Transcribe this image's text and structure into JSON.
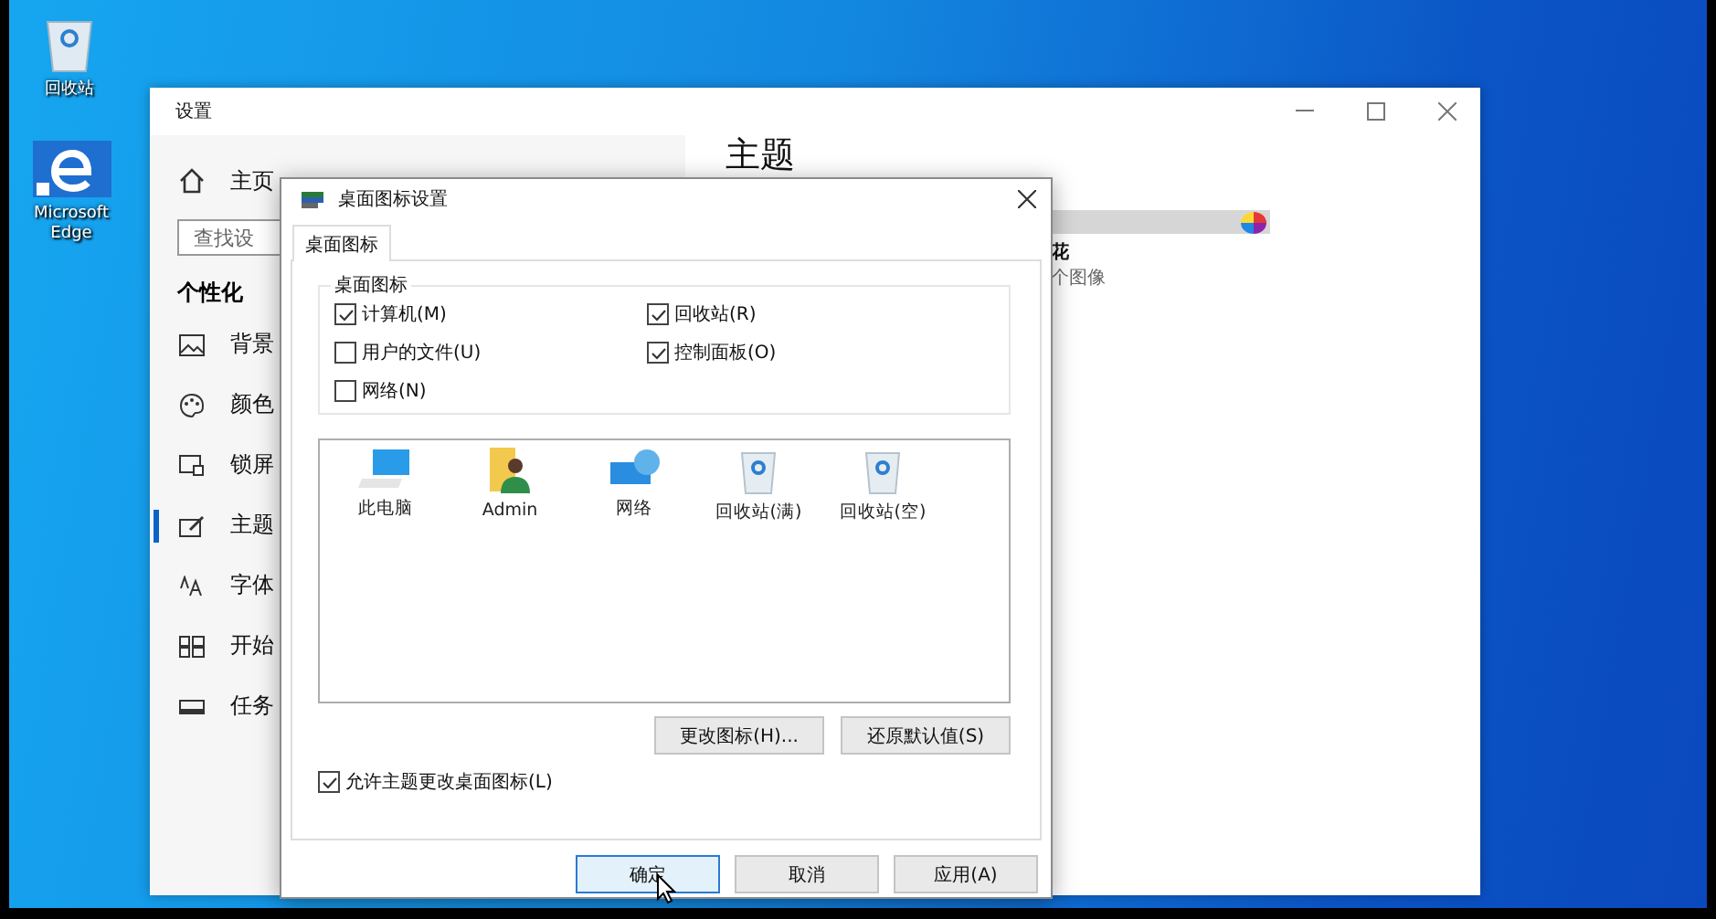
{
  "desktop": {
    "icons": [
      {
        "label": "回收站",
        "kind": "recycle"
      },
      {
        "label": "Microsoft Edge",
        "kind": "edge"
      }
    ]
  },
  "settings_window": {
    "title": "设置",
    "nav": {
      "home": "主页",
      "search": {
        "placeholder": "查找设"
      },
      "section": "个性化",
      "items": [
        {
          "label": "背景",
          "kind": "picture",
          "selected": false
        },
        {
          "label": "颜色",
          "kind": "palette",
          "selected": false
        },
        {
          "label": "锁屏",
          "kind": "lock",
          "selected": false
        },
        {
          "label": "主题",
          "kind": "theme",
          "selected": true
        },
        {
          "label": "字体",
          "kind": "font",
          "selected": false
        },
        {
          "label": "开始",
          "kind": "start",
          "selected": false
        },
        {
          "label": "任务",
          "kind": "taskbar",
          "selected": false
        }
      ]
    },
    "content": {
      "heading": "主题",
      "lines": [
        "花",
        "个图像"
      ]
    }
  },
  "dialog": {
    "title": "桌面图标设置",
    "tabs": [
      {
        "label": "桌面图标",
        "selected": true
      }
    ],
    "group": {
      "label": "桌面图标",
      "checkboxes": [
        {
          "label": "计算机(M)",
          "checked": true
        },
        {
          "label": "回收站(R)",
          "checked": true
        },
        {
          "label": "用户的文件(U)",
          "checked": false
        },
        {
          "label": "控制面板(O)",
          "checked": true
        },
        {
          "label": "网络(N)",
          "checked": false
        }
      ]
    },
    "icons": [
      {
        "label": "此电脑",
        "kind": "computer"
      },
      {
        "label": "Admin",
        "kind": "user"
      },
      {
        "label": "网络",
        "kind": "network"
      },
      {
        "label": "回收站(满)",
        "kind": "recycle"
      },
      {
        "label": "回收站(空)",
        "kind": "recycle"
      }
    ],
    "icon_buttons": [
      "更改图标(H)...",
      "还原默认值(S)"
    ],
    "allow_theme": {
      "label": "允许主题更改桌面图标(L)",
      "checked": true
    },
    "footer_buttons": [
      {
        "label": "确定",
        "focused": true
      },
      {
        "label": "取消",
        "focused": false
      },
      {
        "label": "应用(A)",
        "focused": false
      }
    ]
  }
}
